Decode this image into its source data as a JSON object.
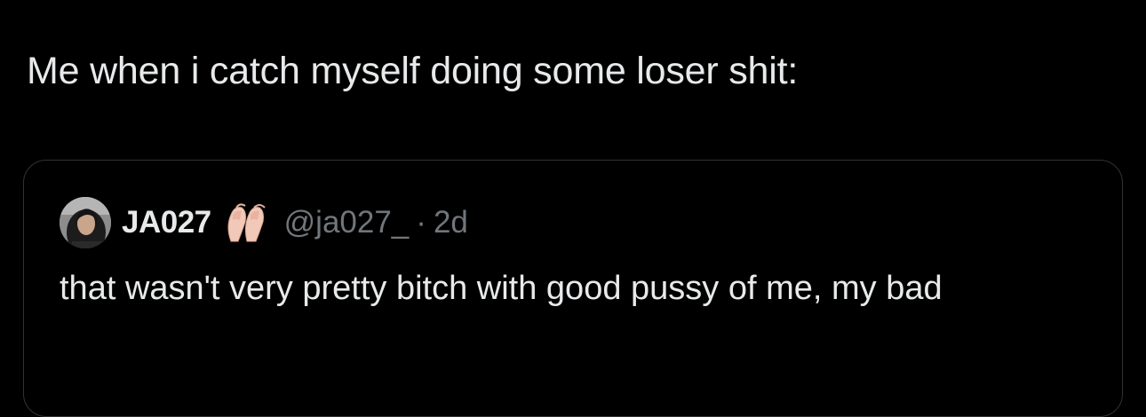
{
  "tweet": {
    "text": "Me when i catch myself doing some loser shit:"
  },
  "quote": {
    "display_name": "JA027",
    "emoji_icon": "ballet-shoes-icon",
    "handle": "@ja027_",
    "separator": "·",
    "time": "2d",
    "text": "that wasn't very pretty bitch with good pussy of me, my bad"
  },
  "colors": {
    "background": "#000000",
    "text_primary": "#e7e9ea",
    "text_secondary": "#71767b",
    "border": "#2f3336"
  }
}
